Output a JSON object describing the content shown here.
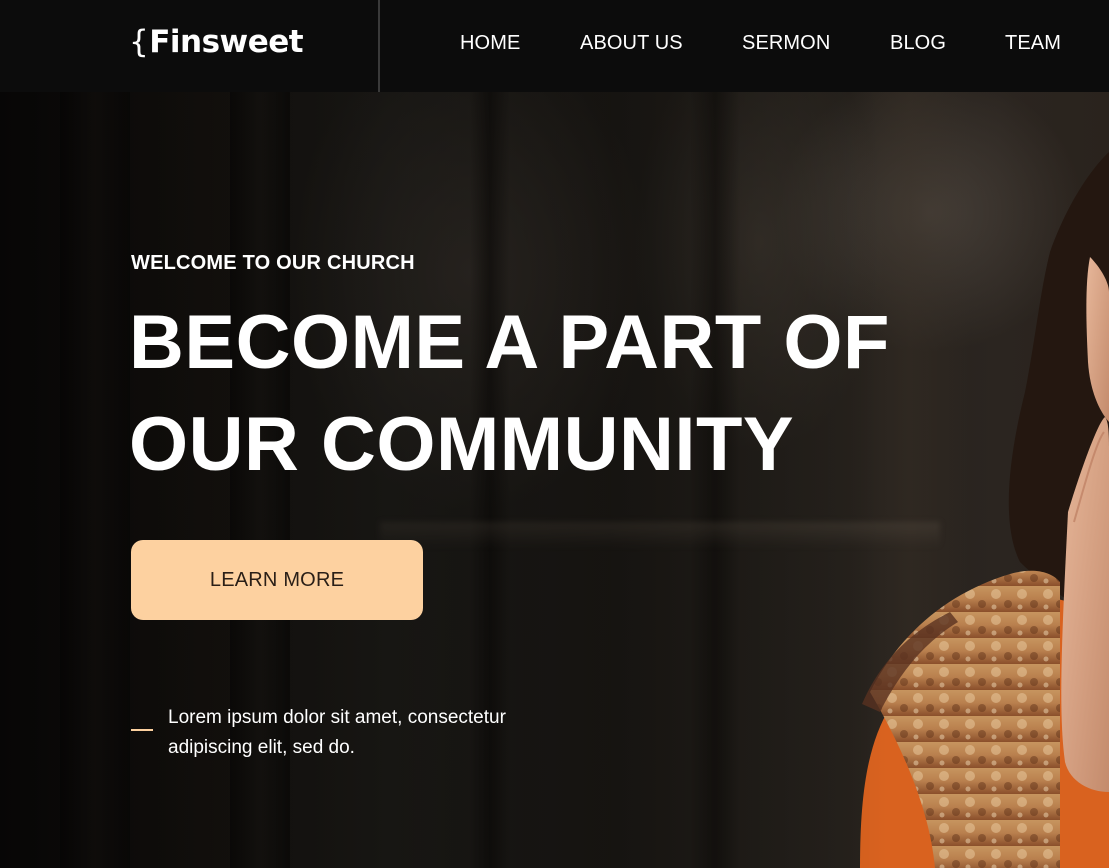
{
  "header": {
    "logo_brace": "{",
    "logo_text": "Finsweet",
    "nav": [
      {
        "label": "HOME"
      },
      {
        "label": "ABOUT US"
      },
      {
        "label": "SERMON"
      },
      {
        "label": "BLOG"
      },
      {
        "label": "TEAM"
      }
    ]
  },
  "hero": {
    "eyebrow": "WELCOME TO OUR CHURCH",
    "headline_line1": "BECOME A PART OF",
    "headline_line2": "OUR COMMUNITY",
    "cta_label": "LEARN MORE",
    "intro": "Lorem ipsum dolor sit amet, consectetur adipiscing elit, sed do."
  },
  "colors": {
    "header_bg": "#0c0c0c",
    "accent": "#fdd1a0",
    "text": "#ffffff",
    "cta_text": "#2a1f17"
  },
  "icons": [
    "dash-icon"
  ]
}
